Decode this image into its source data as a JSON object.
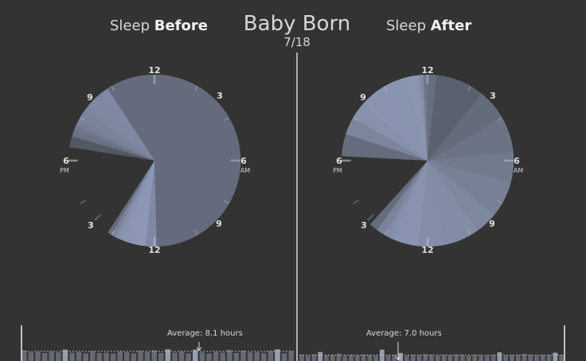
{
  "header": {
    "title": "Baby Born",
    "date": "7/18",
    "left_word": "Sleep",
    "left_emph": "Before",
    "right_word": "Sleep",
    "right_emph": "After"
  },
  "clock_labels": {
    "twelve_top": "12",
    "three_top": "3",
    "six_am": "6",
    "am": "AM",
    "nine_bottom": "9",
    "twelve_bottom": "12",
    "three_bottom": "3",
    "six_pm": "6",
    "pm": "PM",
    "nine_top": "9"
  },
  "averages": {
    "before_text": "Average: 8.1 hours",
    "after_text": "Average: 7.0 hours",
    "before_hours": 8.1,
    "after_hours": 7.0
  },
  "colors": {
    "background": "#333333",
    "sleep_fill": "#9aa6c6",
    "wedge_dark": "#4a4e56",
    "divider": "#d8d8d8",
    "bar": "#6c6f78",
    "bar_light": "#a8b0c6"
  },
  "chart_data": [
    {
      "type": "radial",
      "panel": "before",
      "title": "Sleep Before",
      "unit": "hour of day",
      "wedges": [
        {
          "start": 21.3,
          "end": 6.0,
          "shade": 0.55
        },
        {
          "start": 21.55,
          "end": 6.3,
          "shade": 0.35
        },
        {
          "start": 21.8,
          "end": 6.5,
          "shade": 0.25
        },
        {
          "start": 22.0,
          "end": 6.7,
          "shade": 0.2
        },
        {
          "start": 21.9,
          "end": 6.4,
          "shade": 0.3
        },
        {
          "start": 22.2,
          "end": 6.9,
          "shade": 0.18
        },
        {
          "start": 22.3,
          "end": 7.0,
          "shade": 0.15
        },
        {
          "start": 22.5,
          "end": 6.8,
          "shade": 0.2
        },
        {
          "start": 22.7,
          "end": 7.1,
          "shade": 0.12
        },
        {
          "start": 21.7,
          "end": 6.2,
          "shade": 0.45
        },
        {
          "start": 22.9,
          "end": 5.95,
          "shade": 0.95
        }
      ]
    },
    {
      "type": "radial",
      "panel": "after",
      "title": "Sleep After",
      "unit": "hour of day",
      "wedges": [
        {
          "start": 21.1,
          "end": 6.0,
          "shade": 0.12
        },
        {
          "start": 21.6,
          "end": 6.4,
          "shade": 0.14
        },
        {
          "start": 22.0,
          "end": 7.4,
          "shade": 0.12
        },
        {
          "start": 22.4,
          "end": 6.8,
          "shade": 0.16
        },
        {
          "start": 22.8,
          "end": 6.9,
          "shade": 0.2
        },
        {
          "start": 23.2,
          "end": 7.0,
          "shade": 0.22
        },
        {
          "start": 23.5,
          "end": 7.2,
          "shade": 0.18
        },
        {
          "start": 23.8,
          "end": 6.2,
          "shade": 0.35
        },
        {
          "start": 0.1,
          "end": 5.6,
          "shade": 0.3
        },
        {
          "start": 0.4,
          "end": 4.8,
          "shade": 0.4
        },
        {
          "start": 0.5,
          "end": 4.3,
          "shade": 0.5
        },
        {
          "start": 0.8,
          "end": 3.5,
          "shade": 0.55
        },
        {
          "start": 0.0,
          "end": 2.8,
          "shade": 0.65
        },
        {
          "start": 23.9,
          "end": 2.0,
          "shade": 0.75
        },
        {
          "start": 0.2,
          "end": 1.3,
          "shade": 0.9
        }
      ]
    },
    {
      "type": "bar",
      "panel": "daily-sleep-strip",
      "before_values": [
        8.3,
        7.8,
        7.9,
        7.6,
        8.0,
        7.8,
        8.6,
        7.7,
        7.9,
        7.5,
        8.1,
        7.6,
        7.7,
        7.5,
        8.0,
        7.8,
        7.5,
        8.2,
        7.9,
        8.4,
        7.6,
        8.7,
        7.7,
        8.0,
        7.5,
        8.6,
        7.8,
        7.5,
        8.0,
        7.7,
        8.5,
        7.6,
        8.3,
        7.8,
        7.9,
        7.6,
        8.2,
        8.7,
        7.5,
        8.1
      ],
      "after_values": [
        7.1,
        6.8,
        7.2,
        7.9,
        6.9,
        7.0,
        7.4,
        6.8,
        7.0,
        6.9,
        7.1,
        7.0,
        6.8,
        8.6,
        6.9,
        7.0,
        7.6,
        6.8,
        7.0,
        6.9,
        7.2,
        7.0,
        6.8,
        7.0,
        6.9,
        7.1,
        7.0,
        6.8,
        7.0,
        6.9,
        6.8,
        7.0,
        7.8,
        6.9,
        7.0,
        6.9,
        7.3,
        7.0,
        6.8,
        7.0,
        6.9,
        7.7,
        7.0
      ]
    }
  ]
}
